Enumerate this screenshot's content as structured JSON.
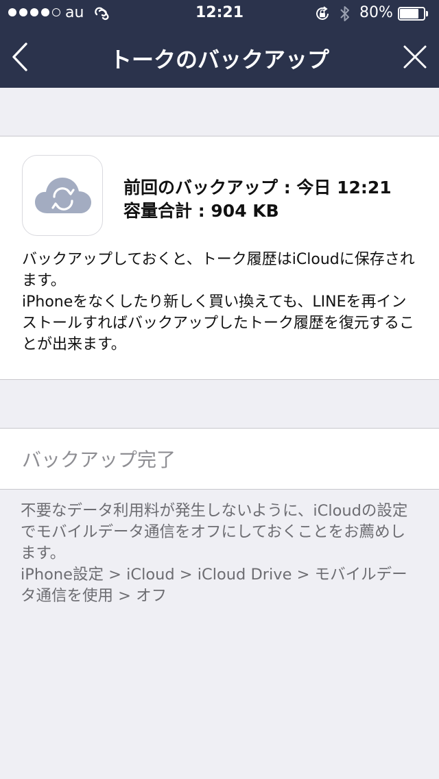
{
  "status_bar": {
    "carrier": "au",
    "time": "12:21",
    "battery_percent": "80%",
    "battery_level": 0.8,
    "signal_bars": 4,
    "signal_max": 5,
    "icons": [
      "signal-dots-icon",
      "link-icon",
      "rotation-lock-icon",
      "bluetooth-icon",
      "battery-icon"
    ]
  },
  "nav": {
    "title": "トークのバックアップ",
    "back_icon": "chevron-left-icon",
    "close_icon": "close-icon"
  },
  "backup": {
    "icon": "cloud-sync-icon",
    "last_backup": "前回のバックアップ : 今日 12:21",
    "total_size": "容量合計 : 904 KB",
    "description_1": "バックアップしておくと、トーク履歴はiCloudに保存されます。",
    "description_2": "iPhoneをなくしたり新しく買い換えても、LINEを再インストールすればバックアップしたトーク履歴を復元することが出来ます。"
  },
  "status": {
    "label": "バックアップ完了"
  },
  "note": {
    "line_1": "不要なデータ利用料が発生しないように、iCloudの設定でモバイルデータ通信をオフにしておくことをお薦めします。",
    "line_2": "iPhone設定 > iCloud > iCloud Drive > モバイルデータ通信を使用 > オフ"
  },
  "colors": {
    "nav_background": "#2b334c",
    "page_background": "#efeff4",
    "cloud_icon": "#a3acc1",
    "muted_text": "#8e8e93"
  }
}
